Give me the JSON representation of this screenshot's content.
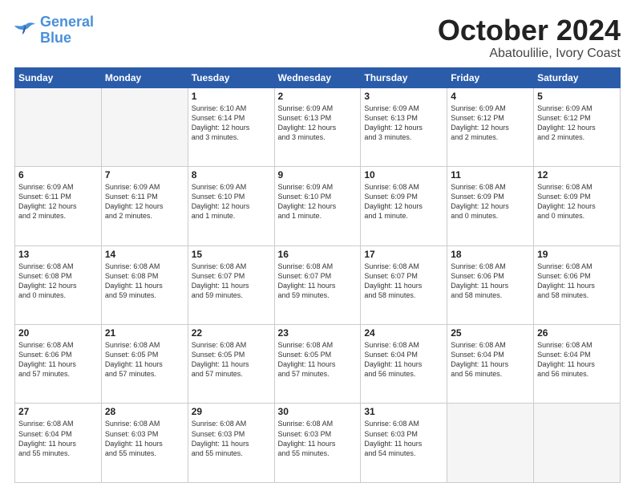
{
  "logo": {
    "line1": "General",
    "line2": "Blue"
  },
  "title": "October 2024",
  "location": "Abatoulilie, Ivory Coast",
  "days_header": [
    "Sunday",
    "Monday",
    "Tuesday",
    "Wednesday",
    "Thursday",
    "Friday",
    "Saturday"
  ],
  "weeks": [
    [
      {
        "day": "",
        "text": ""
      },
      {
        "day": "",
        "text": ""
      },
      {
        "day": "1",
        "text": "Sunrise: 6:10 AM\nSunset: 6:14 PM\nDaylight: 12 hours\nand 3 minutes."
      },
      {
        "day": "2",
        "text": "Sunrise: 6:09 AM\nSunset: 6:13 PM\nDaylight: 12 hours\nand 3 minutes."
      },
      {
        "day": "3",
        "text": "Sunrise: 6:09 AM\nSunset: 6:13 PM\nDaylight: 12 hours\nand 3 minutes."
      },
      {
        "day": "4",
        "text": "Sunrise: 6:09 AM\nSunset: 6:12 PM\nDaylight: 12 hours\nand 2 minutes."
      },
      {
        "day": "5",
        "text": "Sunrise: 6:09 AM\nSunset: 6:12 PM\nDaylight: 12 hours\nand 2 minutes."
      }
    ],
    [
      {
        "day": "6",
        "text": "Sunrise: 6:09 AM\nSunset: 6:11 PM\nDaylight: 12 hours\nand 2 minutes."
      },
      {
        "day": "7",
        "text": "Sunrise: 6:09 AM\nSunset: 6:11 PM\nDaylight: 12 hours\nand 2 minutes."
      },
      {
        "day": "8",
        "text": "Sunrise: 6:09 AM\nSunset: 6:10 PM\nDaylight: 12 hours\nand 1 minute."
      },
      {
        "day": "9",
        "text": "Sunrise: 6:09 AM\nSunset: 6:10 PM\nDaylight: 12 hours\nand 1 minute."
      },
      {
        "day": "10",
        "text": "Sunrise: 6:08 AM\nSunset: 6:09 PM\nDaylight: 12 hours\nand 1 minute."
      },
      {
        "day": "11",
        "text": "Sunrise: 6:08 AM\nSunset: 6:09 PM\nDaylight: 12 hours\nand 0 minutes."
      },
      {
        "day": "12",
        "text": "Sunrise: 6:08 AM\nSunset: 6:09 PM\nDaylight: 12 hours\nand 0 minutes."
      }
    ],
    [
      {
        "day": "13",
        "text": "Sunrise: 6:08 AM\nSunset: 6:08 PM\nDaylight: 12 hours\nand 0 minutes."
      },
      {
        "day": "14",
        "text": "Sunrise: 6:08 AM\nSunset: 6:08 PM\nDaylight: 11 hours\nand 59 minutes."
      },
      {
        "day": "15",
        "text": "Sunrise: 6:08 AM\nSunset: 6:07 PM\nDaylight: 11 hours\nand 59 minutes."
      },
      {
        "day": "16",
        "text": "Sunrise: 6:08 AM\nSunset: 6:07 PM\nDaylight: 11 hours\nand 59 minutes."
      },
      {
        "day": "17",
        "text": "Sunrise: 6:08 AM\nSunset: 6:07 PM\nDaylight: 11 hours\nand 58 minutes."
      },
      {
        "day": "18",
        "text": "Sunrise: 6:08 AM\nSunset: 6:06 PM\nDaylight: 11 hours\nand 58 minutes."
      },
      {
        "day": "19",
        "text": "Sunrise: 6:08 AM\nSunset: 6:06 PM\nDaylight: 11 hours\nand 58 minutes."
      }
    ],
    [
      {
        "day": "20",
        "text": "Sunrise: 6:08 AM\nSunset: 6:06 PM\nDaylight: 11 hours\nand 57 minutes."
      },
      {
        "day": "21",
        "text": "Sunrise: 6:08 AM\nSunset: 6:05 PM\nDaylight: 11 hours\nand 57 minutes."
      },
      {
        "day": "22",
        "text": "Sunrise: 6:08 AM\nSunset: 6:05 PM\nDaylight: 11 hours\nand 57 minutes."
      },
      {
        "day": "23",
        "text": "Sunrise: 6:08 AM\nSunset: 6:05 PM\nDaylight: 11 hours\nand 57 minutes."
      },
      {
        "day": "24",
        "text": "Sunrise: 6:08 AM\nSunset: 6:04 PM\nDaylight: 11 hours\nand 56 minutes."
      },
      {
        "day": "25",
        "text": "Sunrise: 6:08 AM\nSunset: 6:04 PM\nDaylight: 11 hours\nand 56 minutes."
      },
      {
        "day": "26",
        "text": "Sunrise: 6:08 AM\nSunset: 6:04 PM\nDaylight: 11 hours\nand 56 minutes."
      }
    ],
    [
      {
        "day": "27",
        "text": "Sunrise: 6:08 AM\nSunset: 6:04 PM\nDaylight: 11 hours\nand 55 minutes."
      },
      {
        "day": "28",
        "text": "Sunrise: 6:08 AM\nSunset: 6:03 PM\nDaylight: 11 hours\nand 55 minutes."
      },
      {
        "day": "29",
        "text": "Sunrise: 6:08 AM\nSunset: 6:03 PM\nDaylight: 11 hours\nand 55 minutes."
      },
      {
        "day": "30",
        "text": "Sunrise: 6:08 AM\nSunset: 6:03 PM\nDaylight: 11 hours\nand 55 minutes."
      },
      {
        "day": "31",
        "text": "Sunrise: 6:08 AM\nSunset: 6:03 PM\nDaylight: 11 hours\nand 54 minutes."
      },
      {
        "day": "",
        "text": ""
      },
      {
        "day": "",
        "text": ""
      }
    ]
  ]
}
